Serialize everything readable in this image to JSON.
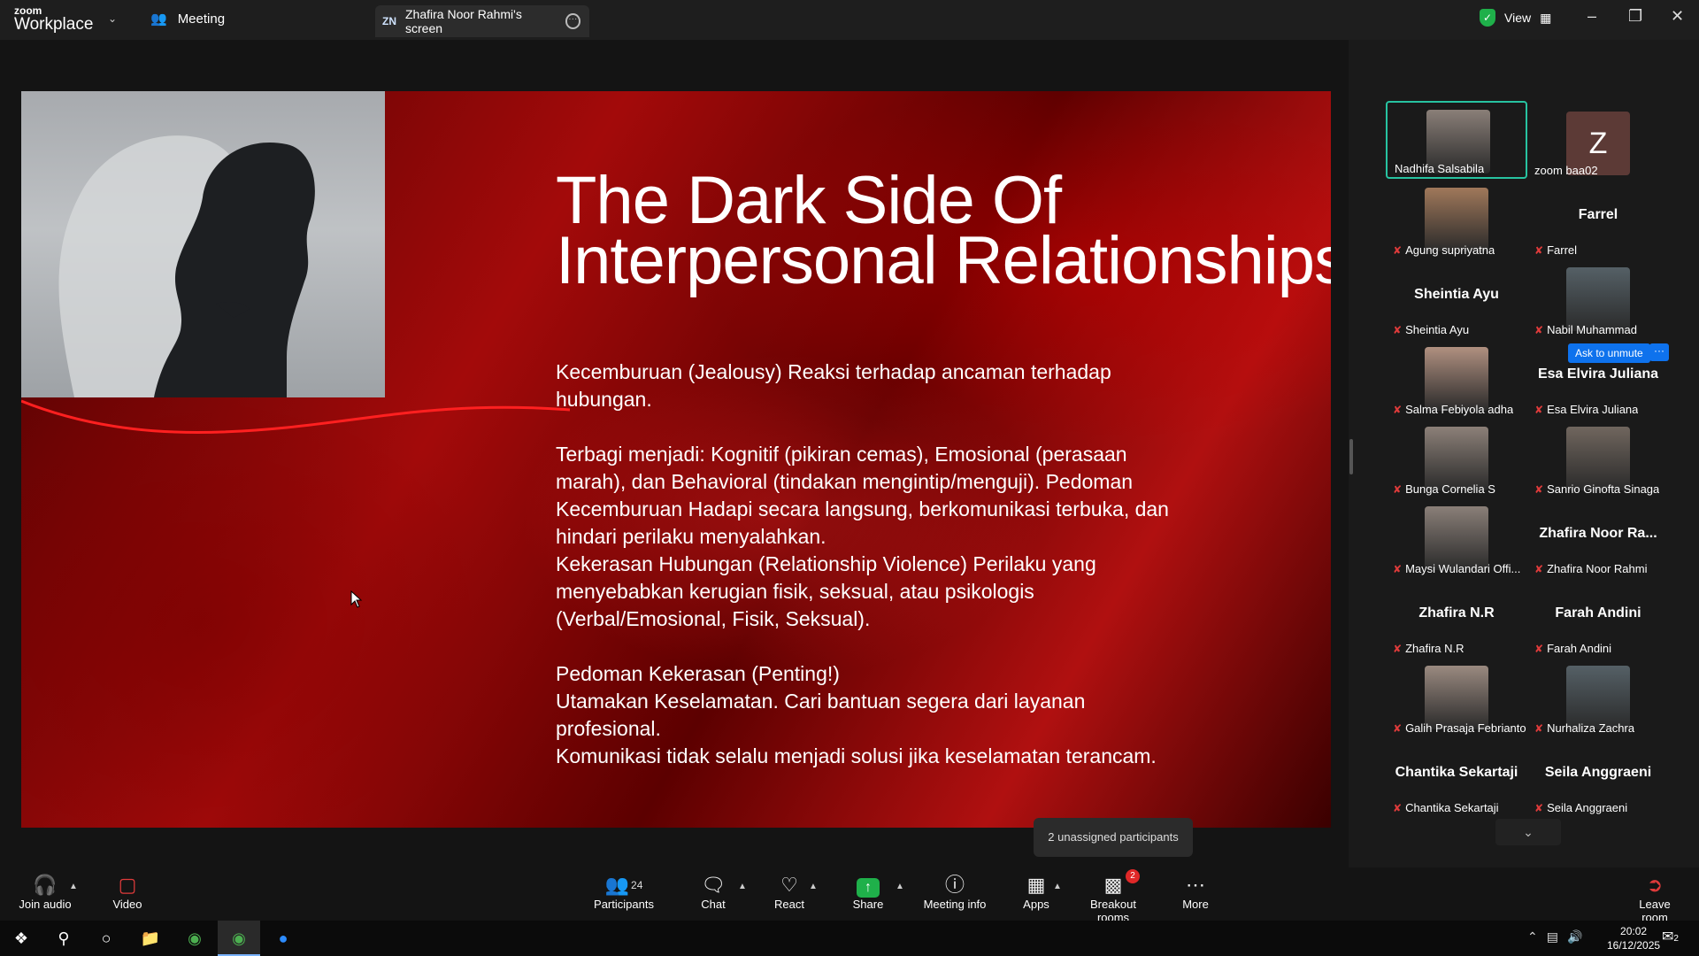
{
  "titlebar": {
    "logo_top": "zoom",
    "logo_bottom": "Workplace",
    "meeting_tab": "Meeting",
    "share_badge": "ZN",
    "share_tab": "Zhafira Noor Rahmi's screen",
    "view_label": "View"
  },
  "slide": {
    "title_line1": "The Dark Side Of",
    "title_line2": "Interpersonal Relationships",
    "p1": "Kecemburuan (Jealousy) Reaksi terhadap ancaman terhadap hubungan.",
    "p2": "Terbagi menjadi: Kognitif (pikiran cemas), Emosional (perasaan marah), dan Behavioral (tindakan mengintip/menguji). Pedoman Kecemburuan Hadapi secara langsung, berkomunikasi terbuka, dan hindari perilaku menyalahkan.",
    "p3": "Kekerasan Hubungan (Relationship Violence) Perilaku yang menyebabkan kerugian fisik, seksual, atau psikologis (Verbal/Emosional, Fisik, Seksual).",
    "p4_title": "Pedoman Kekerasan (Penting!)",
    "p4_line1": "Utamakan Keselamatan. Cari bantuan segera dari layanan profesional.",
    "p4_line2": "Komunikasi tidak selalu menjadi solusi jika keselamatan terancam."
  },
  "participants": [
    {
      "name": "Nadhifa Salsabila",
      "big": "",
      "avatar": "photo",
      "muted": false,
      "active": true
    },
    {
      "name": "zoom baa02",
      "big": "",
      "avatar": "Z",
      "muted": false
    },
    {
      "name": "Agung supriyatna",
      "big": "",
      "avatar": "photo",
      "muted": true
    },
    {
      "name": "Farrel",
      "big": "Farrel",
      "avatar": "",
      "muted": true
    },
    {
      "name": "Sheintia Ayu",
      "big": "Sheintia Ayu",
      "avatar": "",
      "muted": true
    },
    {
      "name": "Nabil Muhammad",
      "big": "",
      "avatar": "photo",
      "muted": true
    },
    {
      "name": "Salma Febiyola adha",
      "big": "",
      "avatar": "photo",
      "muted": true
    },
    {
      "name": "Esa Elvira Juliana",
      "big": "Esa Elvira Juliana",
      "avatar": "",
      "muted": true
    },
    {
      "name": "Bunga Cornelia S",
      "big": "",
      "avatar": "photo",
      "muted": true
    },
    {
      "name": "Sanrio Ginofta Sinaga",
      "big": "",
      "avatar": "photo",
      "muted": true
    },
    {
      "name": "Maysi Wulandari Offi...",
      "big": "",
      "avatar": "photo",
      "muted": true
    },
    {
      "name": "Zhafira Noor Rahmi",
      "big": "Zhafira Noor Ra...",
      "avatar": "",
      "muted": true
    },
    {
      "name": "Zhafira N.R",
      "big": "Zhafira N.R",
      "avatar": "",
      "muted": true
    },
    {
      "name": "Farah Andini",
      "big": "Farah Andini",
      "avatar": "",
      "muted": true
    },
    {
      "name": "Galih Prasaja Febrianto",
      "big": "",
      "avatar": "photo",
      "muted": true
    },
    {
      "name": "Nurhaliza Zachra",
      "big": "",
      "avatar": "photo",
      "muted": true
    },
    {
      "name": "Chantika Sekartaji",
      "big": "Chantika Sekartaji",
      "avatar": "",
      "muted": true
    },
    {
      "name": "Seila Anggraeni",
      "big": "Seila Anggraeni",
      "avatar": "",
      "muted": true
    }
  ],
  "ask_unmute": "Ask to unmute",
  "tooltip": "2 unassigned participants",
  "toolbar": {
    "join_audio": "Join audio",
    "video": "Video",
    "participants": "Participants",
    "participants_count": "24",
    "chat": "Chat",
    "react": "React",
    "share": "Share",
    "meeting_info": "Meeting info",
    "apps": "Apps",
    "breakout": "Breakout rooms",
    "breakout_badge": "2",
    "more": "More",
    "leave": "Leave room"
  },
  "taskbar": {
    "time": "20:02",
    "date": "16/12/2025",
    "notif_count": "2"
  },
  "colors": {
    "accent_blue": "#0e72ed",
    "share_green": "#1fb04a",
    "mute_red": "#e03b3b",
    "active_border": "#27c3a1"
  }
}
